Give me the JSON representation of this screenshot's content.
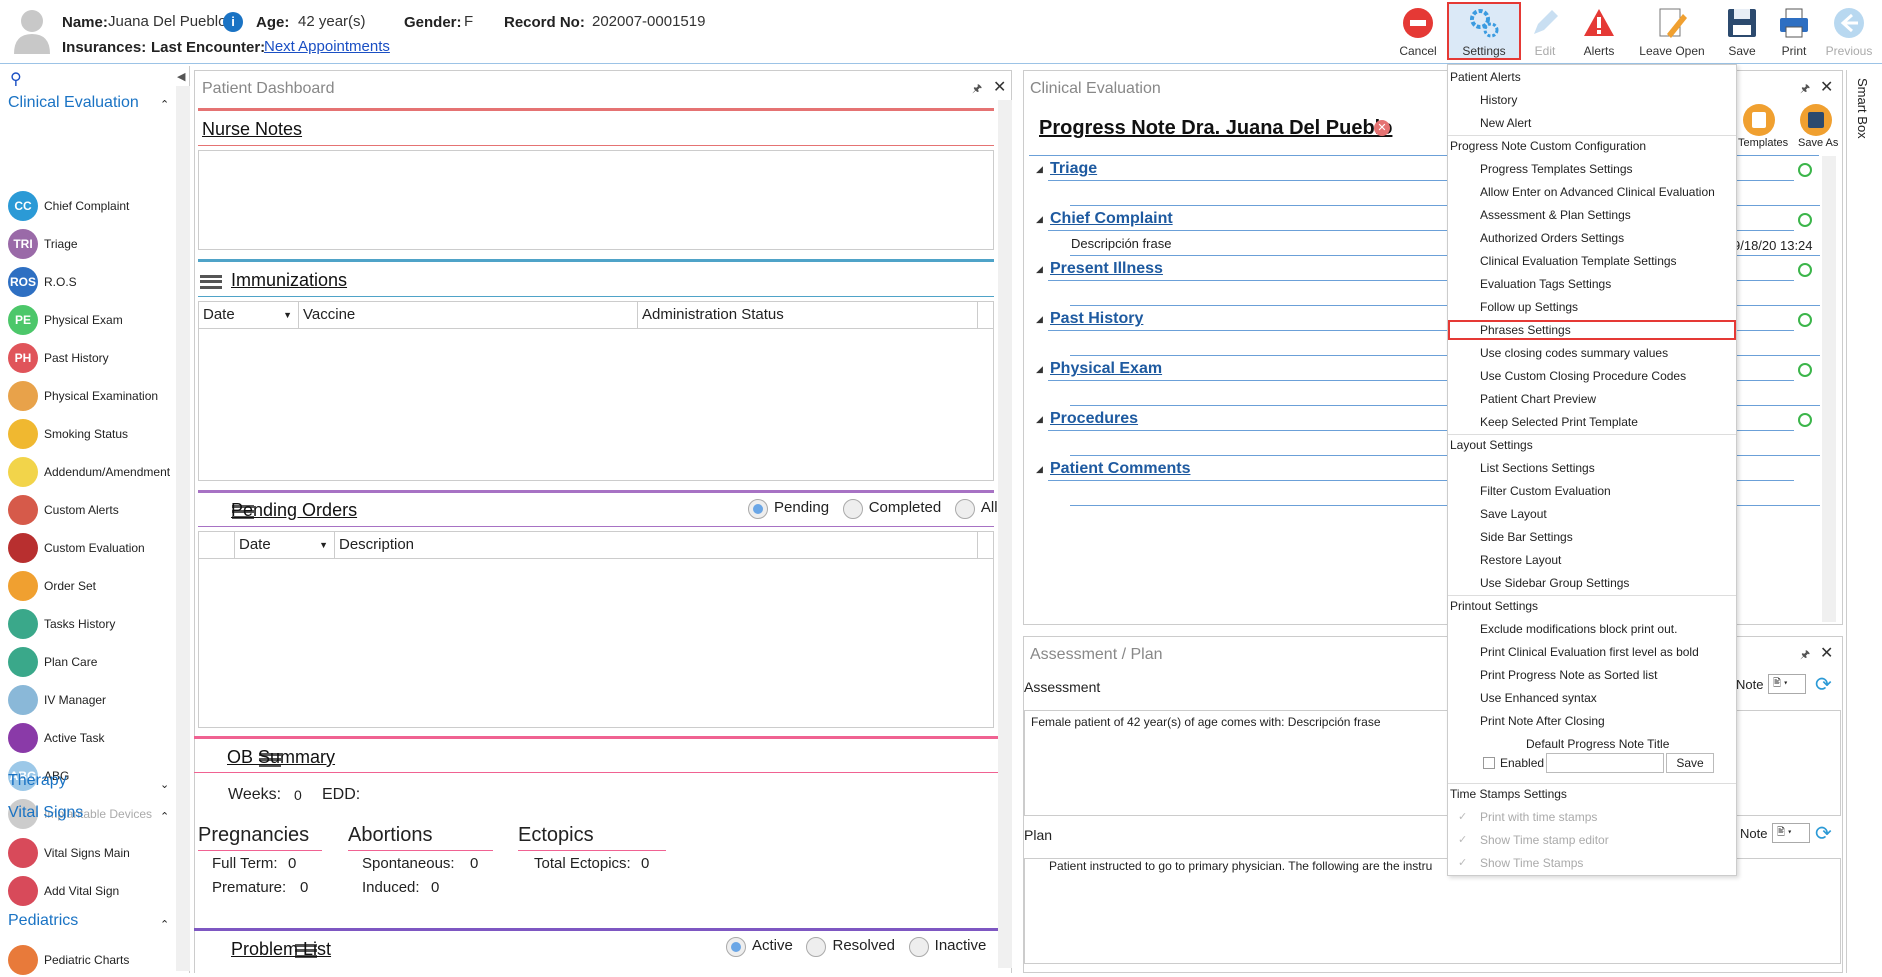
{
  "header": {
    "name_label": "Name:",
    "name_value": "Juana Del Pueblo",
    "age_label": "Age:",
    "age_value": "42 year(s)",
    "gender_label": "Gender:",
    "gender_value": "F",
    "record_label": "Record No:",
    "record_value": "202007-0001519",
    "insurances_label": "Insurances:",
    "last_encounter_label": "Last Encounter:",
    "next_appointments_link": "Next Appointments"
  },
  "toolbar": {
    "cancel": "Cancel",
    "settings": "Settings",
    "edit": "Edit",
    "alerts": "Alerts",
    "leave_open": "Leave Open",
    "save": "Save",
    "print": "Print",
    "previous": "Previous",
    "smart_box": "Smart Box"
  },
  "sidebar": {
    "group_clinical": "Clinical Evaluation",
    "items": [
      {
        "label": "Chief Complaint",
        "abbr": "CC",
        "color": "#2b9ad6"
      },
      {
        "label": "Triage",
        "abbr": "TRI",
        "color": "#9a6aa8"
      },
      {
        "label": "R.O.S",
        "abbr": "ROS",
        "color": "#2e6fc2"
      },
      {
        "label": "Physical Exam",
        "abbr": "PE",
        "color": "#4cc76a"
      },
      {
        "label": "Past History",
        "abbr": "PH",
        "color": "#e0545a"
      },
      {
        "label": "Physical Examination",
        "abbr": "",
        "color": "#e8a24a"
      },
      {
        "label": "Smoking Status",
        "abbr": "",
        "color": "#f0b830"
      },
      {
        "label": "Addendum/Amendment",
        "abbr": "",
        "color": "#f2d44a"
      },
      {
        "label": "Custom Alerts",
        "abbr": "",
        "color": "#d65a4a"
      },
      {
        "label": "Custom Evaluation",
        "abbr": "",
        "color": "#b82f2f"
      },
      {
        "label": "Order Set",
        "abbr": "",
        "color": "#f0a030"
      },
      {
        "label": "Tasks History",
        "abbr": "",
        "color": "#3aa88a"
      },
      {
        "label": "Plan Care",
        "abbr": "",
        "color": "#3aa88a"
      },
      {
        "label": "IV Manager",
        "abbr": "",
        "color": "#8ab8d8"
      },
      {
        "label": "Active Task",
        "abbr": "",
        "color": "#8a3aa8"
      },
      {
        "label": "ABG",
        "abbr": "ABG",
        "color": "#9cc8e8"
      },
      {
        "label": "Implantable Devices",
        "abbr": "",
        "color": "#cccccc"
      }
    ],
    "group_therapy": "Therapy",
    "group_vitals": "Vital Signs",
    "vital_items": [
      {
        "label": "Vital Signs Main",
        "abbr": "",
        "color": "#d84a5a"
      },
      {
        "label": "Add Vital Sign",
        "abbr": "",
        "color": "#d84a5a"
      }
    ],
    "group_pediatrics": "Pediatrics",
    "ped_items": [
      {
        "label": "Pediatric Charts",
        "abbr": "",
        "color": "#e87a3a"
      }
    ]
  },
  "dashboard": {
    "title": "Patient Dashboard",
    "nurse_notes": "Nurse Notes",
    "immunizations": "Immunizations",
    "imm_cols": [
      "Date",
      "Vaccine",
      "Administration Status"
    ],
    "pending_orders": "Pending Orders",
    "po_radios": [
      "Pending",
      "Completed",
      "All"
    ],
    "po_cols": [
      "Date",
      "Description"
    ],
    "ob_summary": "OB Summary",
    "weeks_label": "Weeks:",
    "weeks_value": "0",
    "edd_label": "EDD:",
    "pregnancies": "Pregnancies",
    "full_term_label": "Full Term:",
    "full_term_value": "0",
    "premature_label": "Premature:",
    "premature_value": "0",
    "abortions": "Abortions",
    "spontaneous_label": "Spontaneous:",
    "spontaneous_value": "0",
    "induced_label": "Induced:",
    "induced_value": "0",
    "ectopics": "Ectopics",
    "total_ectopics_label": "Total Ectopics:",
    "total_ectopics_value": "0",
    "problem_list": "Problem List",
    "pl_radios": [
      "Active",
      "Resolved",
      "Inactive"
    ]
  },
  "clinical": {
    "title": "Clinical Evaluation",
    "note_title": "Progress Note Dra. Juana Del Pueblo",
    "templates": "Templates",
    "save_as": "Save As",
    "sections": [
      "Triage",
      "Chief Complaint",
      "Present Illness",
      "Past History",
      "Physical Exam",
      "Procedures",
      "Patient Comments"
    ],
    "descripcion": "Descripción frase",
    "timestamp": "9/18/20 13:24"
  },
  "assessment": {
    "title": "Assessment / Plan",
    "assessment_label": "Assessment",
    "assessment_text": "Female patient of 42 year(s) of age comes with:  Descripción frase",
    "plan_label": "Plan",
    "plan_text": "Patient instructed to go to primary physician.  The following are the instru",
    "note_label": "Note"
  },
  "menu": {
    "patient_alerts": "Patient Alerts",
    "history": "History",
    "new_alert": "New Alert",
    "pn_config": "Progress Note Custom Configuration",
    "pn_items": [
      "Progress Templates Settings",
      "Allow Enter on Advanced Clinical Evaluation",
      "Assessment & Plan Settings",
      "Authorized Orders Settings",
      "Clinical Evaluation Template Settings",
      "Evaluation Tags Settings",
      "Follow up Settings",
      "Phrases Settings",
      "Use closing codes summary values",
      "Use Custom Closing Procedure Codes",
      "Patient Chart Preview",
      "Keep Selected Print Template"
    ],
    "layout_settings": "Layout Settings",
    "layout_items": [
      "List Sections Settings",
      "Filter Custom Evaluation",
      "Save Layout",
      "Side Bar Settings",
      "Restore Layout",
      "Use Sidebar Group Settings"
    ],
    "printout_settings": "Printout Settings",
    "printout_items": [
      "Exclude modifications block print out.",
      "Print Clinical Evaluation first level as bold",
      "Print Progress Note as Sorted list",
      "Use Enhanced syntax",
      "Print Note After Closing"
    ],
    "default_title": "Default Progress Note Title",
    "enabled": "Enabled",
    "save": "Save",
    "time_stamps": "Time Stamps Settings",
    "ts_items": [
      "Print with time stamps",
      "Show Time stamp editor",
      "Show Time Stamps"
    ]
  },
  "colors": {
    "accent": "#1a73c4",
    "highlight": "#e53935"
  }
}
